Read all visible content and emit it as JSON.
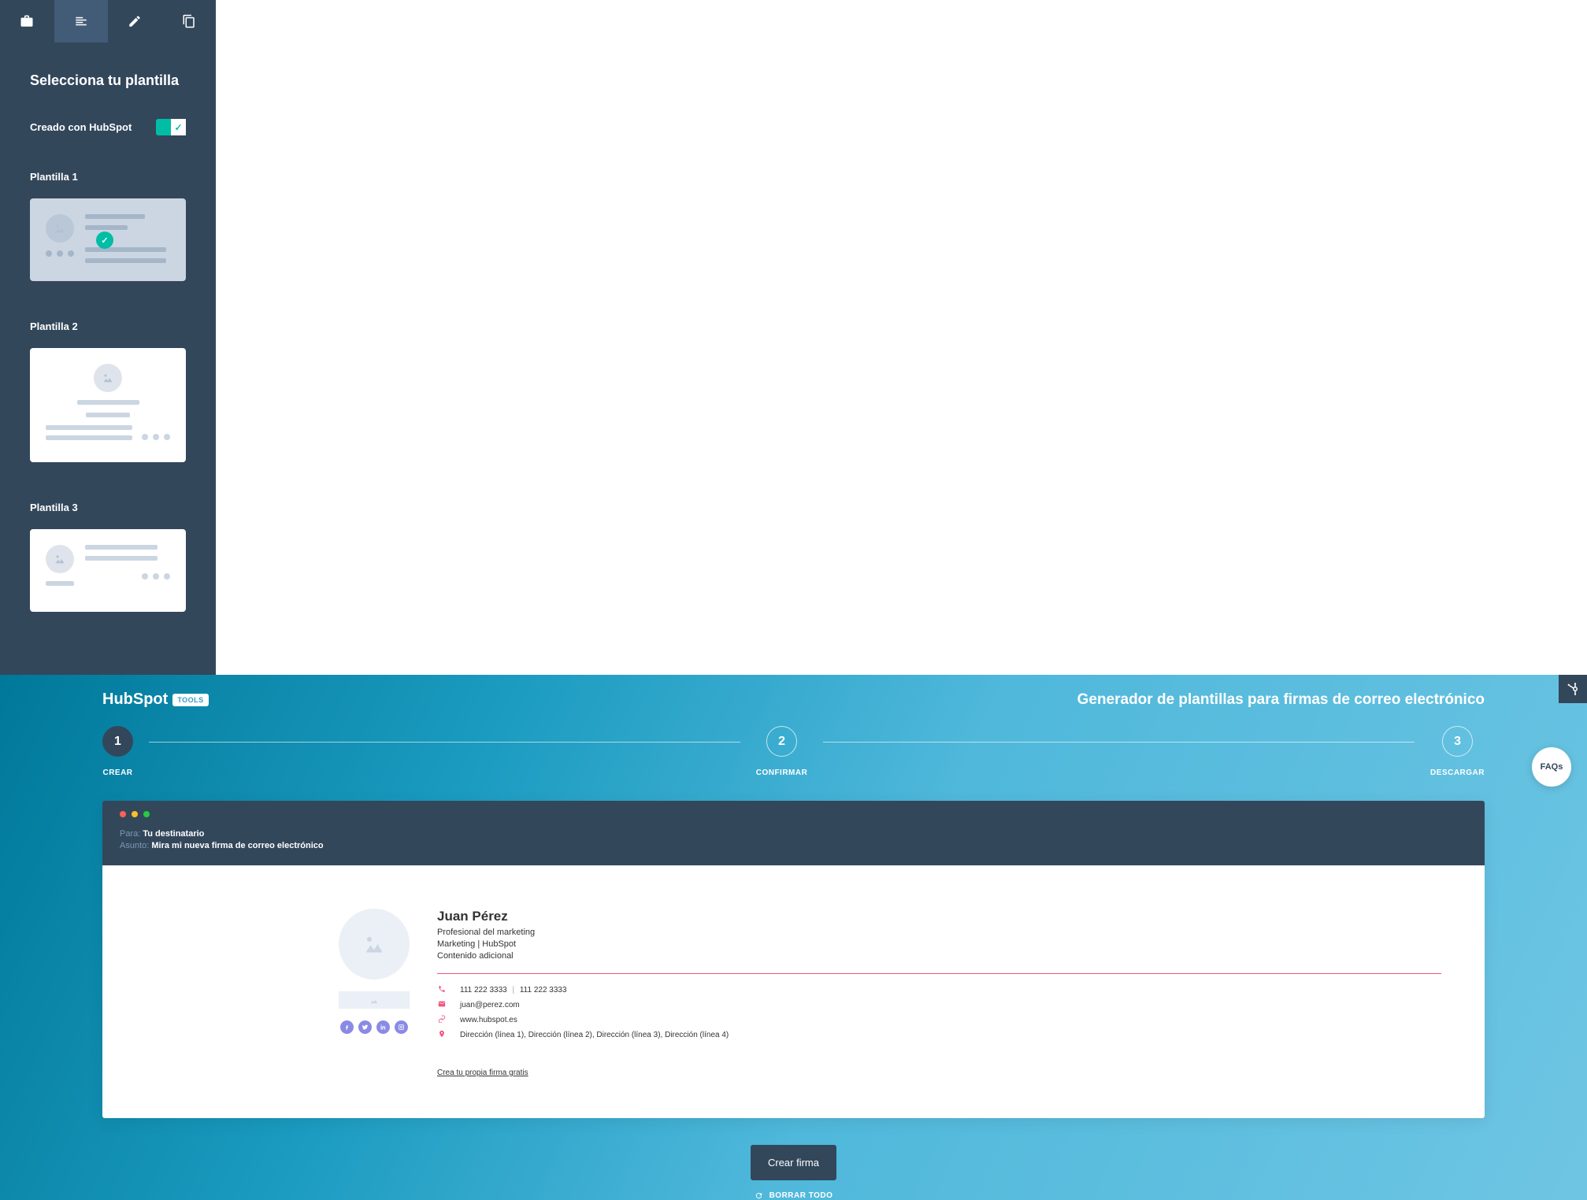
{
  "branding": {
    "logo": "HubSpot",
    "tools_badge": "TOOLS"
  },
  "page_title": "Generador de plantillas para firmas de correo electrónico",
  "sidebar": {
    "title": "Selecciona tu plantilla",
    "created_with_label": "Creado con HubSpot",
    "templates": [
      {
        "label": "Plantilla 1",
        "selected": true
      },
      {
        "label": "Plantilla 2",
        "selected": false
      },
      {
        "label": "Plantilla 3",
        "selected": false
      }
    ]
  },
  "steps": [
    {
      "num": "1",
      "label": "CREAR",
      "active": true
    },
    {
      "num": "2",
      "label": "CONFIRMAR",
      "active": false
    },
    {
      "num": "3",
      "label": "DESCARGAR",
      "active": false
    }
  ],
  "email": {
    "to_label": "Para:",
    "to_value": "Tu destinatario",
    "subject_label": "Asunto:",
    "subject_value": "Mira mi nueva firma de correo electrónico"
  },
  "signature": {
    "name": "Juan Pérez",
    "title": "Profesional del marketing",
    "dept": "Marketing | HubSpot",
    "extra": "Contenido adicional",
    "phone1": "111 222 3333",
    "phone2": "111 222 3333",
    "email": "juan@perez.com",
    "website": "www.hubspot.es",
    "address": "Dirección (línea 1), Dirección (línea 2), Dirección (línea 3), Dirección (línea 4)",
    "cta_link": "Crea tu propia firma gratis"
  },
  "actions": {
    "create": "Crear firma",
    "reset": "BORRAR TODO"
  },
  "faqs_label": "FAQs",
  "colors": {
    "accent": "#f2547d",
    "teal": "#00bda5",
    "navy": "#33475b",
    "social": "#8a8ae6"
  }
}
